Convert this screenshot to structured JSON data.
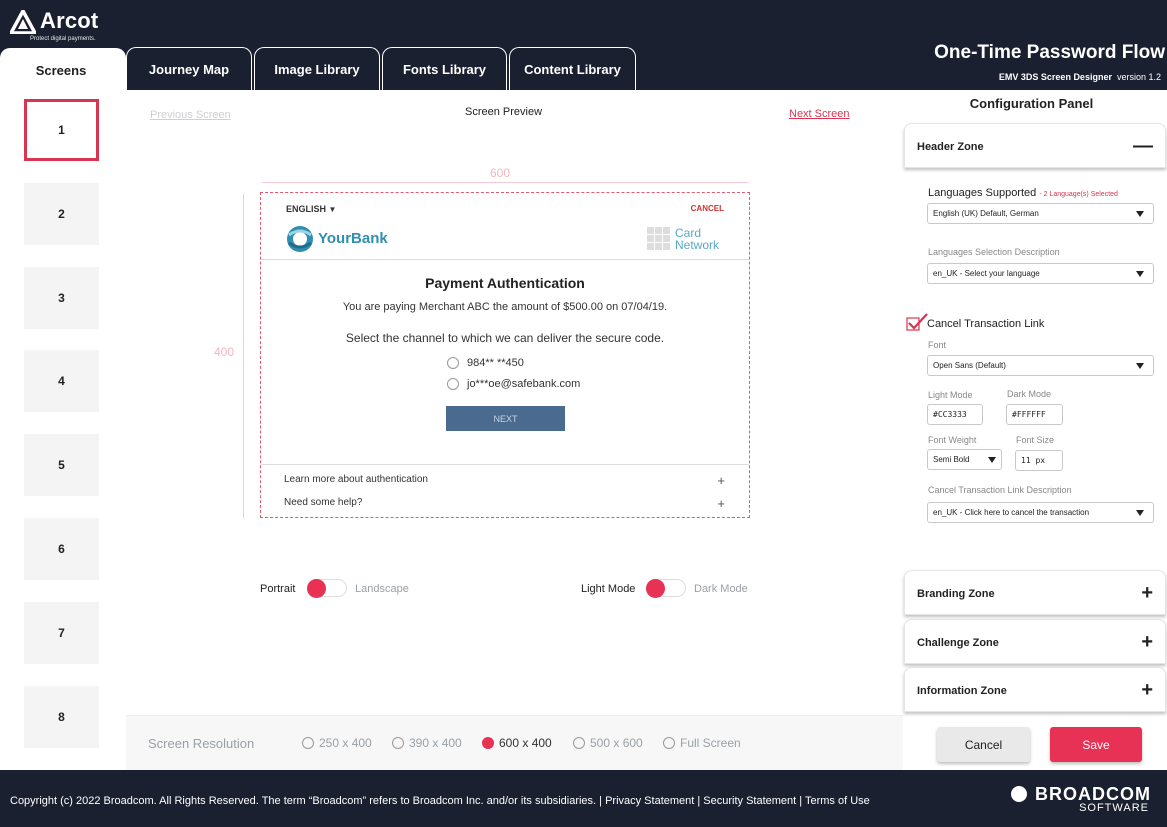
{
  "brand": {
    "name": "Arcot",
    "tagline": "Protect digital payments."
  },
  "flow": {
    "title": "One-Time Password Flow",
    "designer": "EMV 3DS Screen Designer",
    "version": "version 1.2"
  },
  "screens": {
    "title": "Screens",
    "items": [
      "1",
      "2",
      "3",
      "4",
      "5",
      "6",
      "7",
      "8"
    ]
  },
  "tabs": [
    "Journey Map",
    "Image Library",
    "Fonts Library",
    "Content Library"
  ],
  "preview": {
    "prev": "Previous Screen",
    "title": "Screen Preview",
    "next": "Next Screen",
    "width_label": "600",
    "height_label": "400",
    "phone": {
      "language": "ENGLISH",
      "cancel": "CANCEL",
      "bank": "YourBank",
      "card_line1": "Card",
      "card_line2": "Network",
      "heading": "Payment Authentication",
      "paying": "You are paying Merchant ABC the amount of $500.00 on 07/04/19.",
      "select": "Select the channel to which we can deliver the secure code.",
      "options": [
        "984** **450",
        "jo***oe@safebank.com"
      ],
      "next_button": "NEXT",
      "footer": [
        "Learn more about authentication",
        "Need some help?"
      ]
    },
    "orientation": {
      "left": "Portrait",
      "right": "Landscape"
    },
    "mode": {
      "left": "Light Mode",
      "right": "Dark Mode"
    }
  },
  "resolution": {
    "label": "Screen Resolution",
    "options": [
      "250 x 400",
      "390 x 400",
      "600 x 400",
      "500 x 600",
      "Full Screen"
    ],
    "selected": "600 x 400"
  },
  "config": {
    "title": "Configuration Panel",
    "zones": {
      "header": "Header Zone",
      "branding": "Branding Zone",
      "challenge": "Challenge Zone",
      "information": "Information Zone"
    },
    "languages_label": "Languages Supported",
    "languages_count": "- 2 Language(s) Selected",
    "languages_value": "English (UK) Default, German",
    "lang_desc_label": "Languages Selection Description",
    "lang_desc_value": "en_UK - Select your language",
    "cancel_link_label": "Cancel Transaction Link",
    "font_label": "Font",
    "font_value": "Open Sans (Default)",
    "light_mode_label": "Light Mode",
    "light_mode_value": "#CC3333",
    "dark_mode_label": "Dark Mode",
    "dark_mode_value": "#FFFFFF",
    "font_weight_label": "Font Weight",
    "font_weight_value": "Semi Bold",
    "font_size_label": "Font Size",
    "font_size_value": "11 px",
    "cancel_desc_label": "Cancel Transaction Link Description",
    "cancel_desc_value": "en_UK - Click here to cancel the transaction",
    "cancel_button": "Cancel",
    "save_button": "Save"
  },
  "footer": {
    "copyright": "Copyright (c) 2022 Broadcom. All Rights Reserved. The term “Broadcom” refers to Broadcom Inc. and/or its subsidiaries. | Privacy Statement | Security Statement | Terms of Use",
    "company": "BROADCOM",
    "division": "SOFTWARE"
  },
  "colors": {
    "accent": "#e73155",
    "header_bg": "#1b2030",
    "bank_blue": "#2f8fb1"
  }
}
